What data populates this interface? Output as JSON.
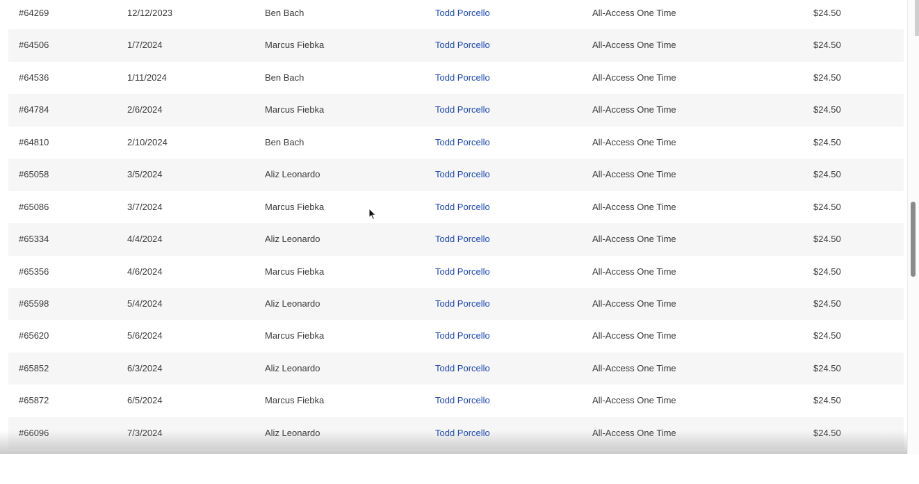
{
  "orders": {
    "rows": [
      {
        "id": "#64269",
        "date": "12/12/2023",
        "user": "Ben Bach",
        "sales_rep": "Todd Porcello",
        "product": "All-Access One Time",
        "price": "$24.50"
      },
      {
        "id": "#64506",
        "date": "1/7/2024",
        "user": "Marcus Fiebka",
        "sales_rep": "Todd Porcello",
        "product": "All-Access One Time",
        "price": "$24.50"
      },
      {
        "id": "#64536",
        "date": "1/11/2024",
        "user": "Ben Bach",
        "sales_rep": "Todd Porcello",
        "product": "All-Access One Time",
        "price": "$24.50"
      },
      {
        "id": "#64784",
        "date": "2/6/2024",
        "user": "Marcus Fiebka",
        "sales_rep": "Todd Porcello",
        "product": "All-Access One Time",
        "price": "$24.50"
      },
      {
        "id": "#64810",
        "date": "2/10/2024",
        "user": "Ben Bach",
        "sales_rep": "Todd Porcello",
        "product": "All-Access One Time",
        "price": "$24.50"
      },
      {
        "id": "#65058",
        "date": "3/5/2024",
        "user": "Aliz Leonardo",
        "sales_rep": "Todd Porcello",
        "product": "All-Access One Time",
        "price": "$24.50"
      },
      {
        "id": "#65086",
        "date": "3/7/2024",
        "user": "Marcus Fiebka",
        "sales_rep": "Todd Porcello",
        "product": "All-Access One Time",
        "price": "$24.50"
      },
      {
        "id": "#65334",
        "date": "4/4/2024",
        "user": "Aliz Leonardo",
        "sales_rep": "Todd Porcello",
        "product": "All-Access One Time",
        "price": "$24.50"
      },
      {
        "id": "#65356",
        "date": "4/6/2024",
        "user": "Marcus Fiebka",
        "sales_rep": "Todd Porcello",
        "product": "All-Access One Time",
        "price": "$24.50"
      },
      {
        "id": "#65598",
        "date": "5/4/2024",
        "user": "Aliz Leonardo",
        "sales_rep": "Todd Porcello",
        "product": "All-Access One Time",
        "price": "$24.50"
      },
      {
        "id": "#65620",
        "date": "5/6/2024",
        "user": "Marcus Fiebka",
        "sales_rep": "Todd Porcello",
        "product": "All-Access One Time",
        "price": "$24.50"
      },
      {
        "id": "#65852",
        "date": "6/3/2024",
        "user": "Aliz Leonardo",
        "sales_rep": "Todd Porcello",
        "product": "All-Access One Time",
        "price": "$24.50"
      },
      {
        "id": "#65872",
        "date": "6/5/2024",
        "user": "Marcus Fiebka",
        "sales_rep": "Todd Porcello",
        "product": "All-Access One Time",
        "price": "$24.50"
      },
      {
        "id": "#66096",
        "date": "7/3/2024",
        "user": "Aliz Leonardo",
        "sales_rep": "Todd Porcello",
        "product": "All-Access One Time",
        "price": "$24.50"
      }
    ]
  },
  "colors": {
    "link": "#1a46b8",
    "row_alt": "#f6f6f6",
    "text": "#3a3a3a"
  },
  "icons": {
    "cursor": "arrow-cursor-icon"
  }
}
